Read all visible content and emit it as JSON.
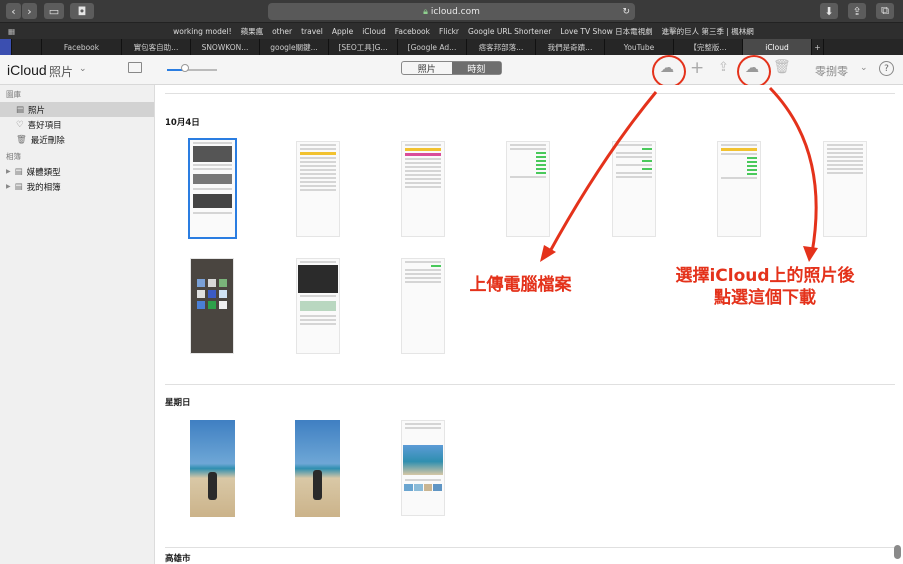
{
  "browser": {
    "url": "icloud.com",
    "bookmarks": [
      "working model!",
      "蘋果瘋",
      "other",
      "travel",
      "Apple",
      "iCloud",
      "Facebook",
      "Flickr",
      "Google URL Shortener",
      "Love TV Show 日本電視劇",
      "進擊的巨人 第三季 | 楓林網"
    ],
    "tabs": [
      "Facebook",
      "實包客自助...",
      "SNOWKON...",
      "google關鍵...",
      "[SEO工具]G...",
      "[Google Ad...",
      "痞客邦部落...",
      "我們是奇蹟...",
      "YouTube",
      "【完整版...",
      "iCloud"
    ]
  },
  "app": {
    "title": "iCloud",
    "section": "照片",
    "view_tabs": [
      "照片",
      "時刻"
    ],
    "user": "零捌零",
    "help": "?"
  },
  "sidebar": {
    "library_heading": "圖庫",
    "items": [
      "照片",
      "喜好項目",
      "最近刪除"
    ],
    "albums_heading": "相簿",
    "album_items": [
      "媒體類型",
      "我的相簿"
    ]
  },
  "sections": [
    {
      "title": "10月4日"
    },
    {
      "title": "星期日"
    },
    {
      "title": "高雄市"
    }
  ],
  "annotations": {
    "upload": "上傳電腦檔案",
    "download_line1": "選擇iCloud上的照片後",
    "download_line2": "點選這個下載"
  },
  "colors": {
    "annotation": "#e4321b",
    "selection": "#2a7de1",
    "toggle": "#49c95b"
  }
}
